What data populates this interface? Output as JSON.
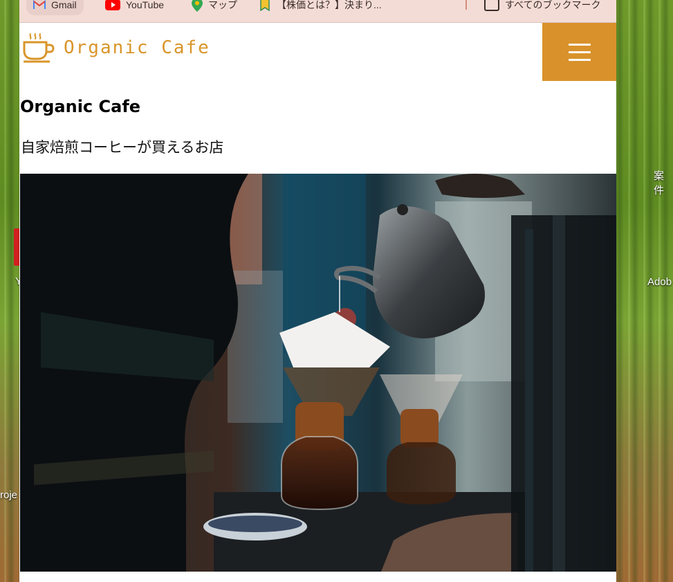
{
  "desktop": {
    "right_labels": [
      "案件",
      "Adob"
    ],
    "left_labels": [
      "Y",
      "roje"
    ]
  },
  "bookmarks": [
    {
      "label": "Gmail",
      "icon": "gmail-icon"
    },
    {
      "label": "YouTube",
      "icon": "youtube-icon"
    },
    {
      "label": "マップ",
      "icon": "maps-icon"
    },
    {
      "label": "【株価とは？】決まり...",
      "icon": "bookmark-icon"
    },
    {
      "label": "すべてのブックマーク",
      "icon": "folder-icon"
    }
  ],
  "site": {
    "logo_text": "Organic Cafe",
    "title": "Organic Cafe",
    "tagline": "自家焙煎コーヒーが買えるお店"
  },
  "colors": {
    "accent": "#d9922b",
    "bookmark_bar": "#f4dcd6"
  }
}
